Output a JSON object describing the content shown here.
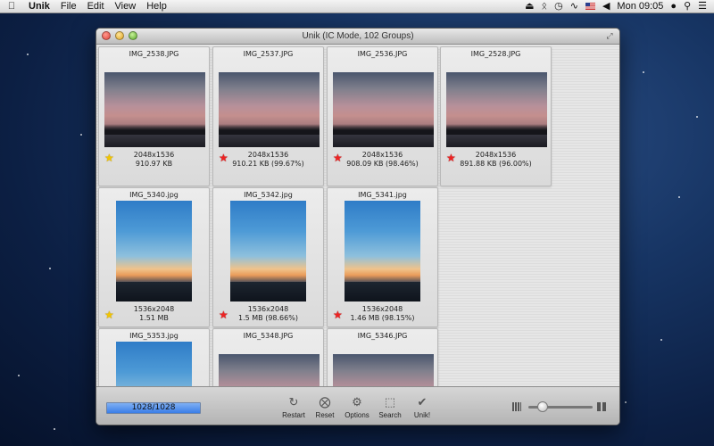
{
  "menubar": {
    "app_name": "Unik",
    "items": [
      "File",
      "Edit",
      "View",
      "Help"
    ],
    "clock": "Mon 09:05"
  },
  "window": {
    "title": "Unik (IC Mode, 102 Groups)"
  },
  "cards": [
    {
      "name": "IMG_2538.JPG",
      "resolution": "2048x1536",
      "size": "910.97 KB",
      "star": "gold",
      "orientation": "land"
    },
    {
      "name": "IMG_2537.JPG",
      "resolution": "2048x1536",
      "size": "910.21 KB (99.67%)",
      "star": "red",
      "orientation": "land"
    },
    {
      "name": "IMG_2536.JPG",
      "resolution": "2048x1536",
      "size": "908.09 KB (98.46%)",
      "star": "red",
      "orientation": "land"
    },
    {
      "name": "IMG_2528.JPG",
      "resolution": "2048x1536",
      "size": "891.88 KB (96.00%)",
      "star": "red",
      "orientation": "land"
    },
    {
      "name": "IMG_5340.jpg",
      "resolution": "1536x2048",
      "size": "1.51 MB",
      "star": "gold",
      "orientation": "port"
    },
    {
      "name": "IMG_5342.jpg",
      "resolution": "1536x2048",
      "size": "1.5 MB (98.66%)",
      "star": "red",
      "orientation": "port"
    },
    {
      "name": "IMG_5341.jpg",
      "resolution": "1536x2048",
      "size": "1.46 MB (98.15%)",
      "star": "red",
      "orientation": "port"
    },
    {
      "name": "IMG_5353.jpg",
      "orientation": "port"
    },
    {
      "name": "IMG_5348.JPG",
      "orientation": "land"
    },
    {
      "name": "IMG_5346.JPG",
      "orientation": "land"
    }
  ],
  "toolbar": {
    "progress_text": "1028/1028",
    "progress_fraction": 1.0,
    "restart_label": "Restart",
    "reset_label": "Reset",
    "options_label": "Options",
    "search_label": "Search",
    "unik_label": "Unik!",
    "zoom_fraction": 0.2
  },
  "colors": {
    "star_gold": "#f2c500",
    "star_red": "#e22222",
    "progress_blue": "#3a7ee8"
  }
}
